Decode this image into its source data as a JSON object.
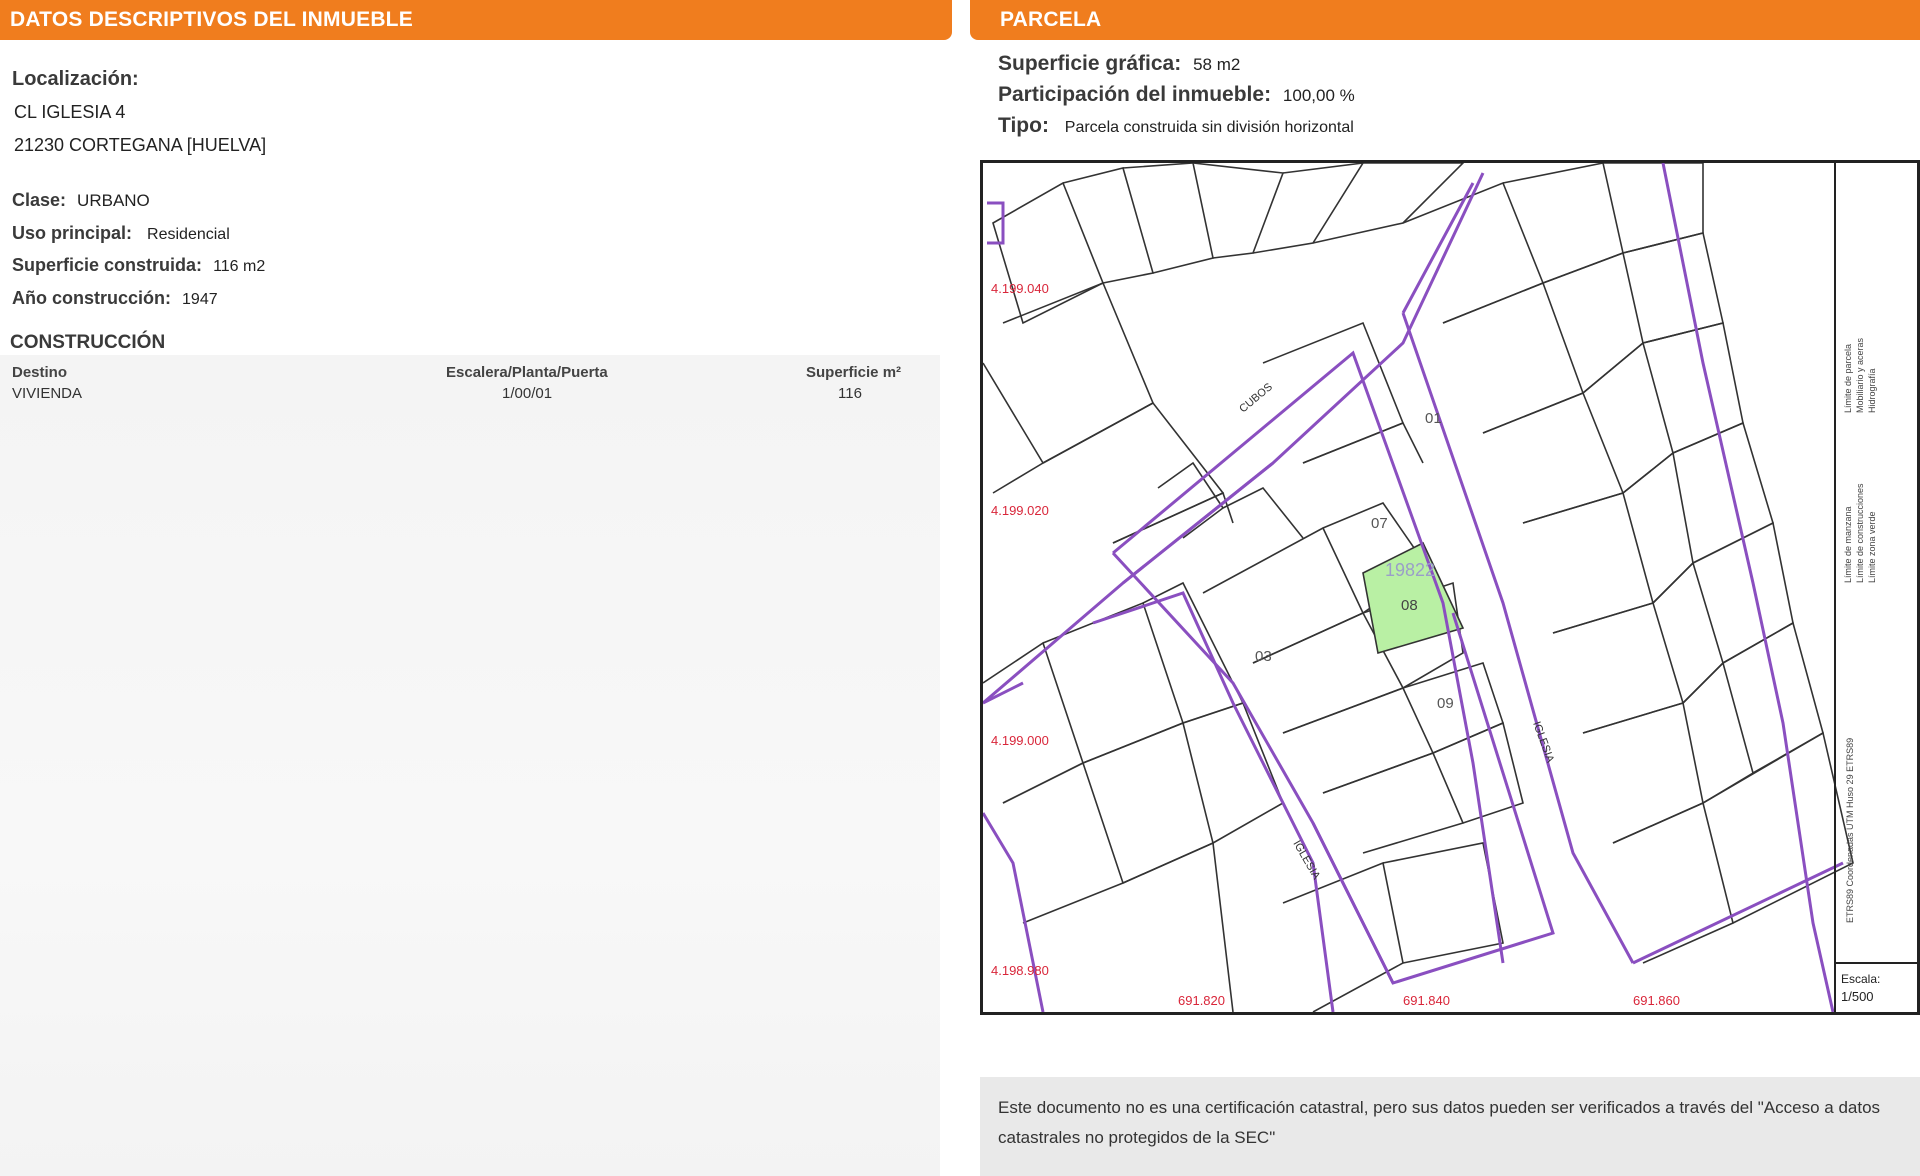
{
  "left_header": "DATOS DESCRIPTIVOS DEL INMUEBLE",
  "right_header": "PARCELA",
  "localizacion": {
    "label": "Localización:",
    "line1": "CL IGLESIA 4",
    "line2": "21230 CORTEGANA [HUELVA]"
  },
  "clase": {
    "label": "Clase:",
    "value": "URBANO"
  },
  "uso": {
    "label": "Uso principal:",
    "value": "Residencial"
  },
  "superficie_construida": {
    "label": "Superficie construida:",
    "value": "116 m2"
  },
  "anio": {
    "label": "Año construcción:",
    "value": "1947"
  },
  "construccion": {
    "title": "CONSTRUCCIÓN",
    "headers": [
      "Destino",
      "Escalera/Planta/Puerta",
      "Superficie m²"
    ],
    "rows": [
      [
        "VIVIENDA",
        "1/00/01",
        "116"
      ]
    ]
  },
  "parcela": {
    "superficie_grafica": {
      "label": "Superficie gráfica:",
      "value": "58 m2"
    },
    "participacion": {
      "label": "Participación del inmueble:",
      "value": "100,00 %"
    },
    "tipo": {
      "label": "Tipo:",
      "value": "Parcela construida sin división horizontal"
    }
  },
  "map": {
    "coord_y": [
      "4.199.040",
      "4.199.020",
      "4.199.000",
      "4.198.980"
    ],
    "coord_x": [
      "691.820",
      "691.840",
      "691.860"
    ],
    "parcel_numbers": [
      "07",
      "08",
      "09",
      "03",
      "01"
    ],
    "block_number": "19822",
    "streets": [
      "IGLESIA",
      "IGLESIA",
      "IGLESIA",
      "CUBOS"
    ],
    "legend": [
      "Límite de manzana",
      "Límite de parcela",
      "Límite de construcciones",
      "Mobiliario y aceras",
      "Límite zona verde",
      "Hidrografía"
    ],
    "legend_ref": "ETRS89 Coordenadas UTM Huso 29 ETRS89",
    "scale_label": "Escala:",
    "scale_value": "1/500"
  },
  "note": "Este documento no es una certificación catastral, pero sus datos pueden ser verificados a través del \"Acceso a datos catastrales no protegidos de la SEC\"",
  "colors": {
    "header": "#f07d1e",
    "parcel_fill": "#b9f0a4",
    "block_line": "#8a4fc0",
    "coord_text": "#d9263a"
  }
}
